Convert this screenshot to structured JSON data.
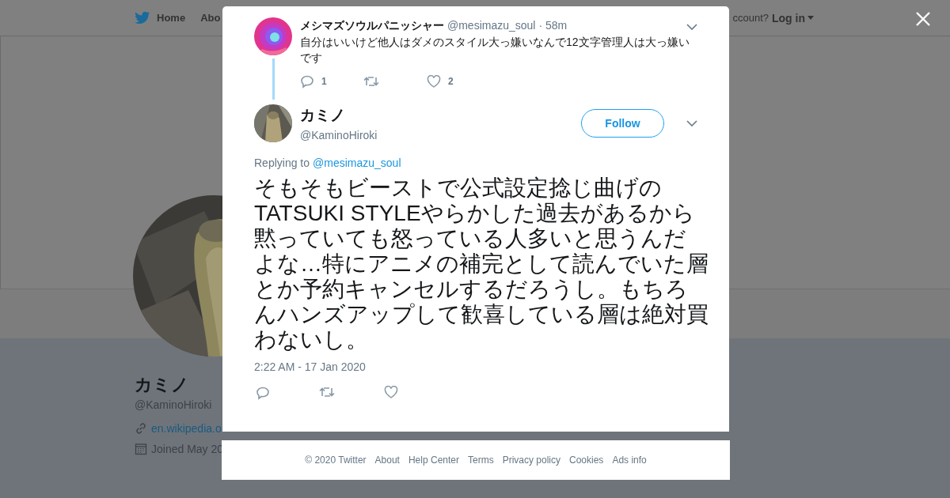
{
  "top_nav": {
    "links": [
      {
        "label": "Home"
      },
      {
        "label": "Abo"
      }
    ],
    "account_prompt": "ccount?",
    "login": "Log in"
  },
  "profile": {
    "name": "カミノ",
    "handle": "@KaminoHiroki",
    "link": "en.wikipedia.o",
    "joined": "Joined May 20"
  },
  "thread": {
    "parent": {
      "name": "メシマズソウルパニッシャー",
      "handle": "@mesimazu_soul",
      "time": "· 58m",
      "text": "自分はいいけど他人はダメのスタイル大っ嫌いなんで12文字管理人は大っ嫌いです",
      "reply_count": "1",
      "like_count": "2"
    },
    "tweet": {
      "name": "カミノ",
      "handle": "@KaminoHiroki",
      "follow": "Follow",
      "replying_prefix": "Replying to",
      "replying_to": "@mesimazu_soul",
      "text": "そもそもビーストで公式設定捻じ曲げのTATSUKI STYLEやらかした過去があるから黙っていても怒っている人多いと思うんだよな…特にアニメの補完として読んでいた層とか予約キャンセルするだろうし。もちろんハンズアップして歓喜している層は絶対買わないし。",
      "timestamp": "2:22 AM - 17 Jan 2020"
    }
  },
  "footer": [
    "© 2020 Twitter",
    "About",
    "Help Center",
    "Terms",
    "Privacy policy",
    "Cookies",
    "Ads info"
  ]
}
